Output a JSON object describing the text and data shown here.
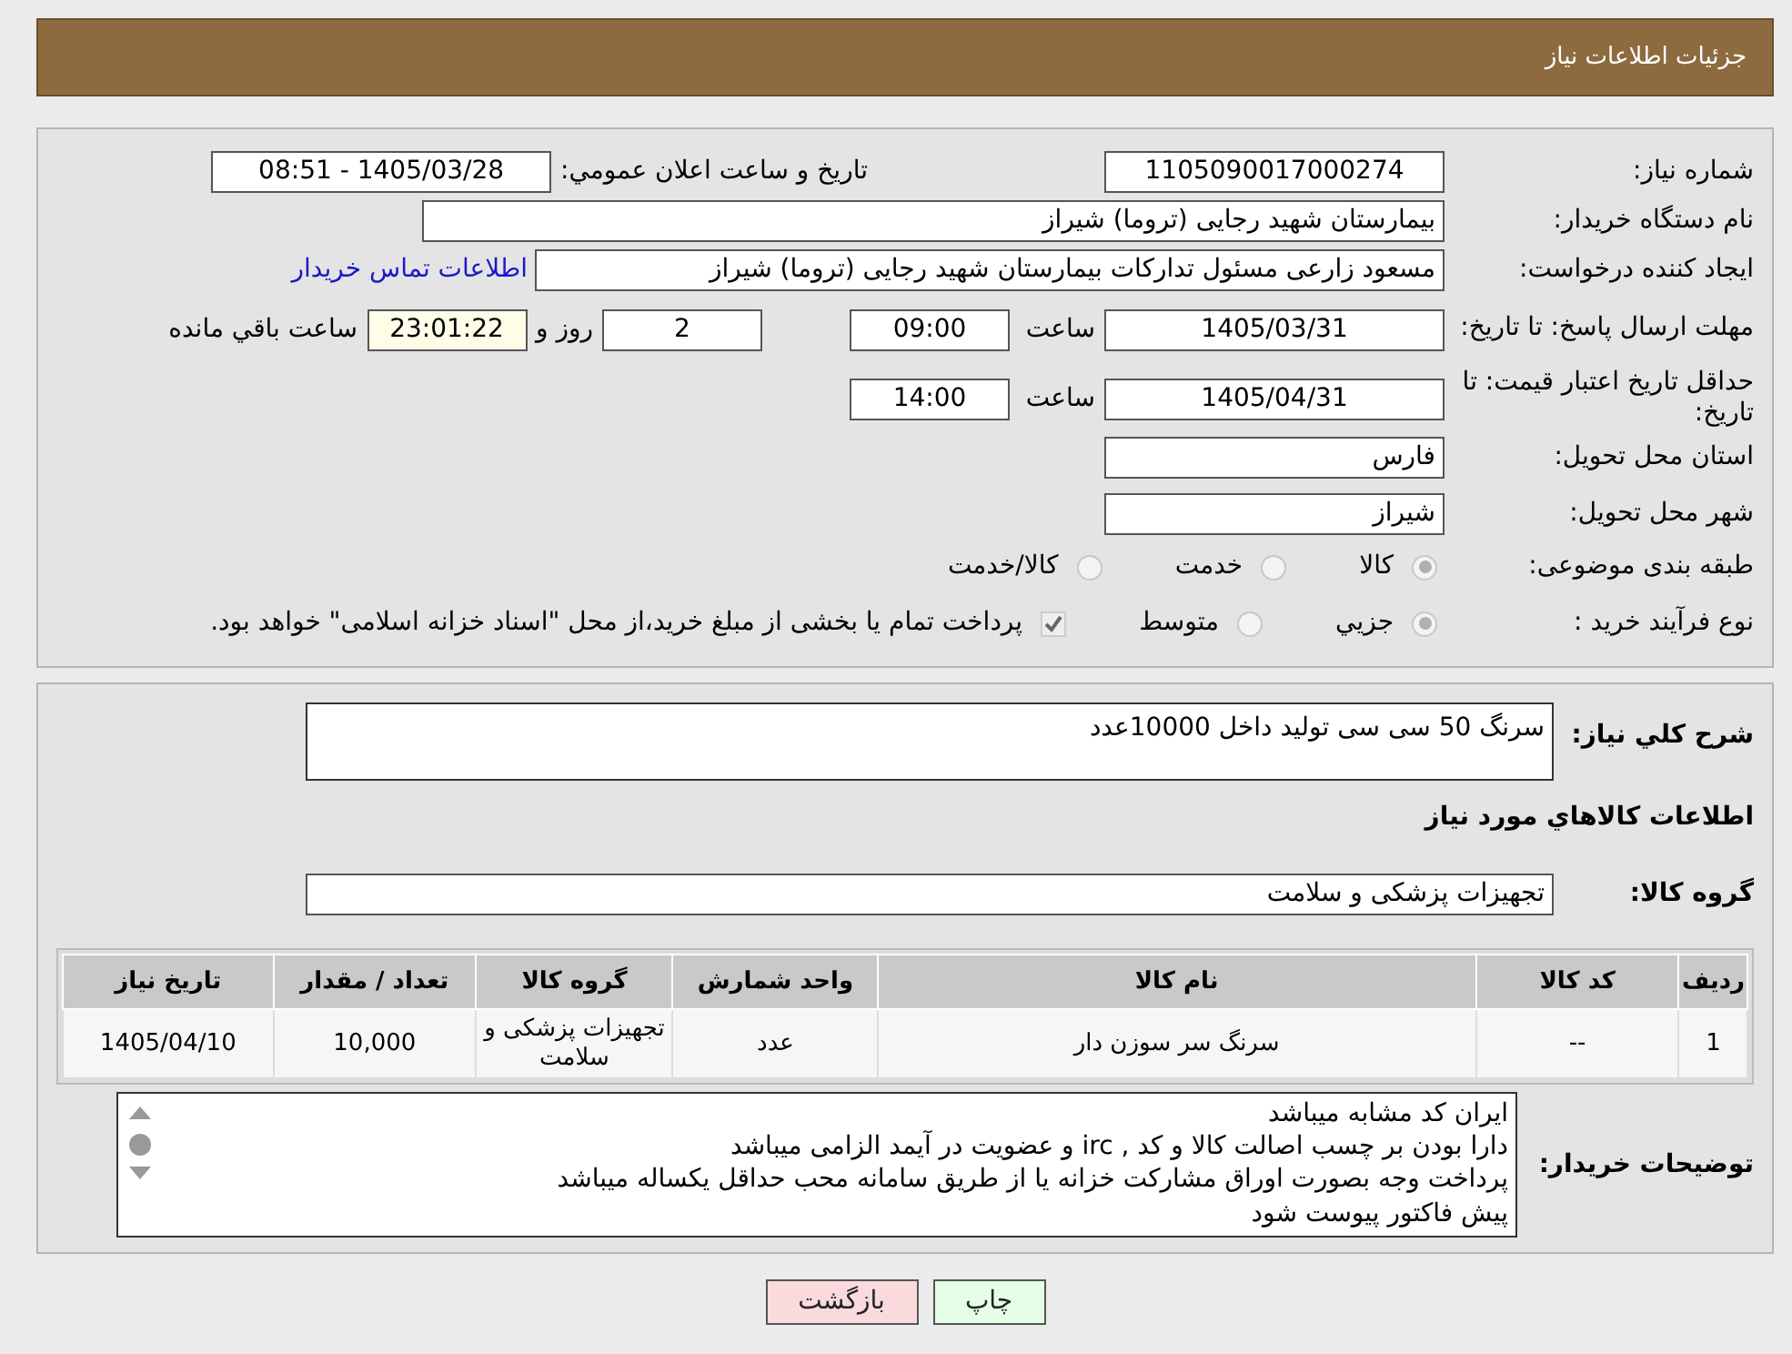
{
  "header": {
    "title": "جزئیات اطلاعات نیاز"
  },
  "need_number": {
    "label": "شماره نیاز:",
    "value": "1105090017000274"
  },
  "announce": {
    "label": "تاريخ و ساعت اعلان عمومي:",
    "value": "1405/03/28 - 08:51"
  },
  "buyer_org": {
    "label": "نام دستگاه خریدار:",
    "value": "بیمارستان شهید رجایی (تروما) شیراز"
  },
  "requester": {
    "label": "ایجاد کننده درخواست:",
    "value": "مسعود زارعی مسئول تدارکات بیمارستان شهید رجایی (تروما) شیراز",
    "link": "اطلاعات تماس خریدار"
  },
  "deadline": {
    "label": "مهلت ارسال پاسخ: تا تاریخ:",
    "date": "1405/03/31",
    "time_label": "ساعت",
    "time": "09:00",
    "days": "2",
    "days_label": "روز و",
    "remaining": "23:01:22",
    "remaining_label": "ساعت باقي مانده"
  },
  "price_validity": {
    "label": "حداقل تاریخ اعتبار قیمت: تا تاریخ:",
    "date": "1405/04/31",
    "time_label": "ساعت",
    "time": "14:00"
  },
  "province": {
    "label": "استان محل تحویل:",
    "value": "فارس"
  },
  "city": {
    "label": "شهر محل تحویل:",
    "value": "شیراز"
  },
  "category": {
    "label": "طبقه بندی موضوعی:",
    "options": [
      {
        "label": "کالا",
        "selected": true
      },
      {
        "label": "خدمت",
        "selected": false
      },
      {
        "label": "کالا/خدمت",
        "selected": false
      }
    ]
  },
  "process": {
    "label": "نوع فرآیند خرید :",
    "options": [
      {
        "label": "جزيي",
        "selected": true
      },
      {
        "label": "متوسط",
        "selected": false
      }
    ],
    "treasury": {
      "checked": true,
      "text": "پرداخت تمام یا بخشی از مبلغ خرید،از محل \"اسناد خزانه اسلامی\" خواهد بود."
    }
  },
  "description": {
    "label": "شرح كلي نياز:",
    "value": "سرنگ 50 سی سی تولید داخل 10000عدد"
  },
  "goods_heading": "اطلاعات كالاهاي مورد نياز",
  "goods_group": {
    "label": "گروه كالا:",
    "value": "تجهیزات پزشکی و سلامت"
  },
  "table": {
    "columns": [
      "ردیف",
      "کد کالا",
      "نام کالا",
      "واحد شمارش",
      "گروه کالا",
      "تعداد / مقدار",
      "تاریخ نیاز"
    ],
    "rows": [
      [
        "1",
        "--",
        "سرنگ سر سوزن دار",
        "عدد",
        "تجهیزات پزشکی و سلامت",
        "10,000",
        "1405/04/10"
      ]
    ]
  },
  "buyer_notes": {
    "label": "توضیحات خریدار:",
    "lines": [
      "ایران کد مشابه میباشد",
      "دارا بودن بر چسب اصالت کالا و کد ,  irc و عضویت در آیمد الزامی میباشد",
      "پرداخت وجه بصورت اوراق مشارکت خزانه یا از طریق سامانه محب  حداقل یکساله میباشد",
      "پیش فاکتور پیوست شود"
    ]
  },
  "buttons": [
    {
      "label": "چاپ",
      "kind": "print"
    },
    {
      "label": "بازگشت",
      "kind": "back"
    }
  ]
}
